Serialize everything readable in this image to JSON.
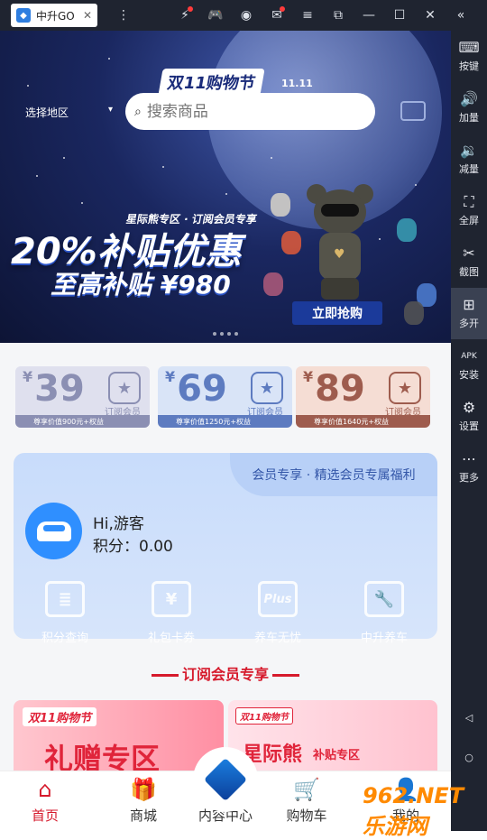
{
  "window": {
    "tab_title": "中升GO",
    "tab_close": "✕",
    "icons": [
      "tab-list-icon",
      "boost-icon",
      "gamepad-icon",
      "account-icon",
      "mail-icon",
      "menu-icon",
      "popout-icon",
      "minimize-icon",
      "maximize-icon",
      "close-icon",
      "collapse-icon"
    ]
  },
  "sidebar": {
    "items": [
      {
        "label": "按键",
        "icon": "keyboard-icon",
        "glyph": "⌨"
      },
      {
        "label": "加量",
        "icon": "volume-up-icon",
        "glyph": "🔊"
      },
      {
        "label": "减量",
        "icon": "volume-down-icon",
        "glyph": "🔉"
      },
      {
        "label": "全屏",
        "icon": "fullscreen-icon",
        "glyph": "⛶"
      },
      {
        "label": "截图",
        "icon": "scissors-icon",
        "glyph": "✂"
      },
      {
        "label": "多开",
        "icon": "multi-instance-icon",
        "glyph": "⊞"
      },
      {
        "label": "安装",
        "icon": "apk-icon",
        "glyph": "APK"
      },
      {
        "label": "设置",
        "icon": "settings-icon",
        "glyph": "⚙"
      },
      {
        "label": "更多",
        "icon": "more-icon",
        "glyph": "⋯"
      }
    ],
    "nav_back": "◁",
    "nav_home": "○"
  },
  "banner": {
    "festival": "双11购物节",
    "festival_date": "11.11",
    "region": "选择地区",
    "region_caret": "▾",
    "search_placeholder": "搜索商品",
    "vip_zone": "星际熊专区 · 订阅会员专享",
    "promo_main": "20%补贴优惠",
    "promo_sub": "至高补贴 ¥980",
    "buy_now": "立即抢购"
  },
  "plans": [
    {
      "currency": "¥",
      "price": "39",
      "badge": "订阅会员",
      "foot": "尊享价值900元+权益",
      "color": "#8b8fb3",
      "bg": "#dfe0ee"
    },
    {
      "currency": "¥",
      "price": "69",
      "badge": "订阅会员",
      "foot": "尊享价值1250元+权益",
      "color": "#5d7bc0",
      "bg": "#d9e4f7"
    },
    {
      "currency": "¥",
      "price": "89",
      "badge": "订阅会员",
      "foot": "尊享价值1640元+权益",
      "color": "#9e5c4e",
      "bg": "#f5ddd4"
    }
  ],
  "member": {
    "slogan": "会员专享 · 精选会员专属福利",
    "greeting": "Hi,游客",
    "points": "积分：0.00",
    "actions": [
      {
        "label": "积分查询",
        "icon": "points-query-icon",
        "glyph": "≣"
      },
      {
        "label": "礼包卡券",
        "icon": "coupon-icon",
        "glyph": "¥"
      },
      {
        "label": "养车无忧",
        "icon": "plus-icon",
        "glyph": "Plus"
      },
      {
        "label": "中升养车",
        "icon": "car-service-icon",
        "glyph": "🔧"
      }
    ]
  },
  "section_title": "订阅会员专享",
  "promos": {
    "left_tag": "双11购物节",
    "left_big": "礼赠专区",
    "right_tag": "双11购物节",
    "right_big": "星际熊",
    "right_small": "补贴专区"
  },
  "tabbar": {
    "items": [
      {
        "label": "首页",
        "glyph": "⌂",
        "icon": "home-icon"
      },
      {
        "label": "商城",
        "glyph": "🎁",
        "icon": "gift-icon"
      },
      {
        "label": "内容中心",
        "glyph": "",
        "icon": "content-center-icon"
      },
      {
        "label": "购物车",
        "glyph": "🛒",
        "icon": "cart-icon"
      },
      {
        "label": "我的",
        "glyph": "👤",
        "icon": "profile-icon"
      }
    ]
  },
  "watermark": "962.NET 乐游网"
}
